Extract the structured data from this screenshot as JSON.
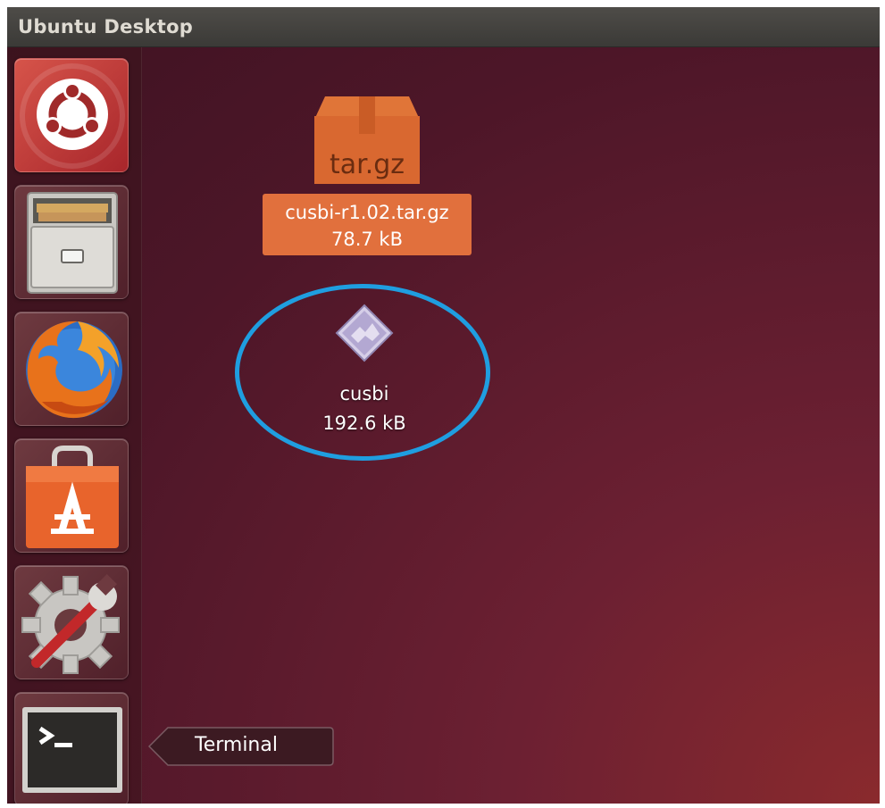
{
  "topbar": {
    "title": "Ubuntu Desktop"
  },
  "launcher": {
    "items": [
      {
        "name": "ubuntu-dash",
        "icon": "ubuntu-logo-icon"
      },
      {
        "name": "files",
        "icon": "file-cabinet-icon"
      },
      {
        "name": "firefox",
        "icon": "firefox-icon"
      },
      {
        "name": "software-center",
        "icon": "shopping-bag-icon"
      },
      {
        "name": "system-settings",
        "icon": "gear-wrench-icon"
      },
      {
        "name": "terminal",
        "icon": "terminal-icon"
      }
    ],
    "tooltip": "Terminal"
  },
  "desktop": {
    "icons": [
      {
        "name": "cusbi-r1.02.tar.gz",
        "size": "78.7 kB",
        "icon": "archive-box-icon",
        "badge": "tar.gz",
        "selected": true
      },
      {
        "name": "cusbi",
        "size": "192.6 kB",
        "icon": "executable-diamond-icon",
        "selected": false
      }
    ],
    "highlight_color": "#1f9ee0"
  },
  "colors": {
    "selection": "#e1703d",
    "background": "#4d1628"
  }
}
